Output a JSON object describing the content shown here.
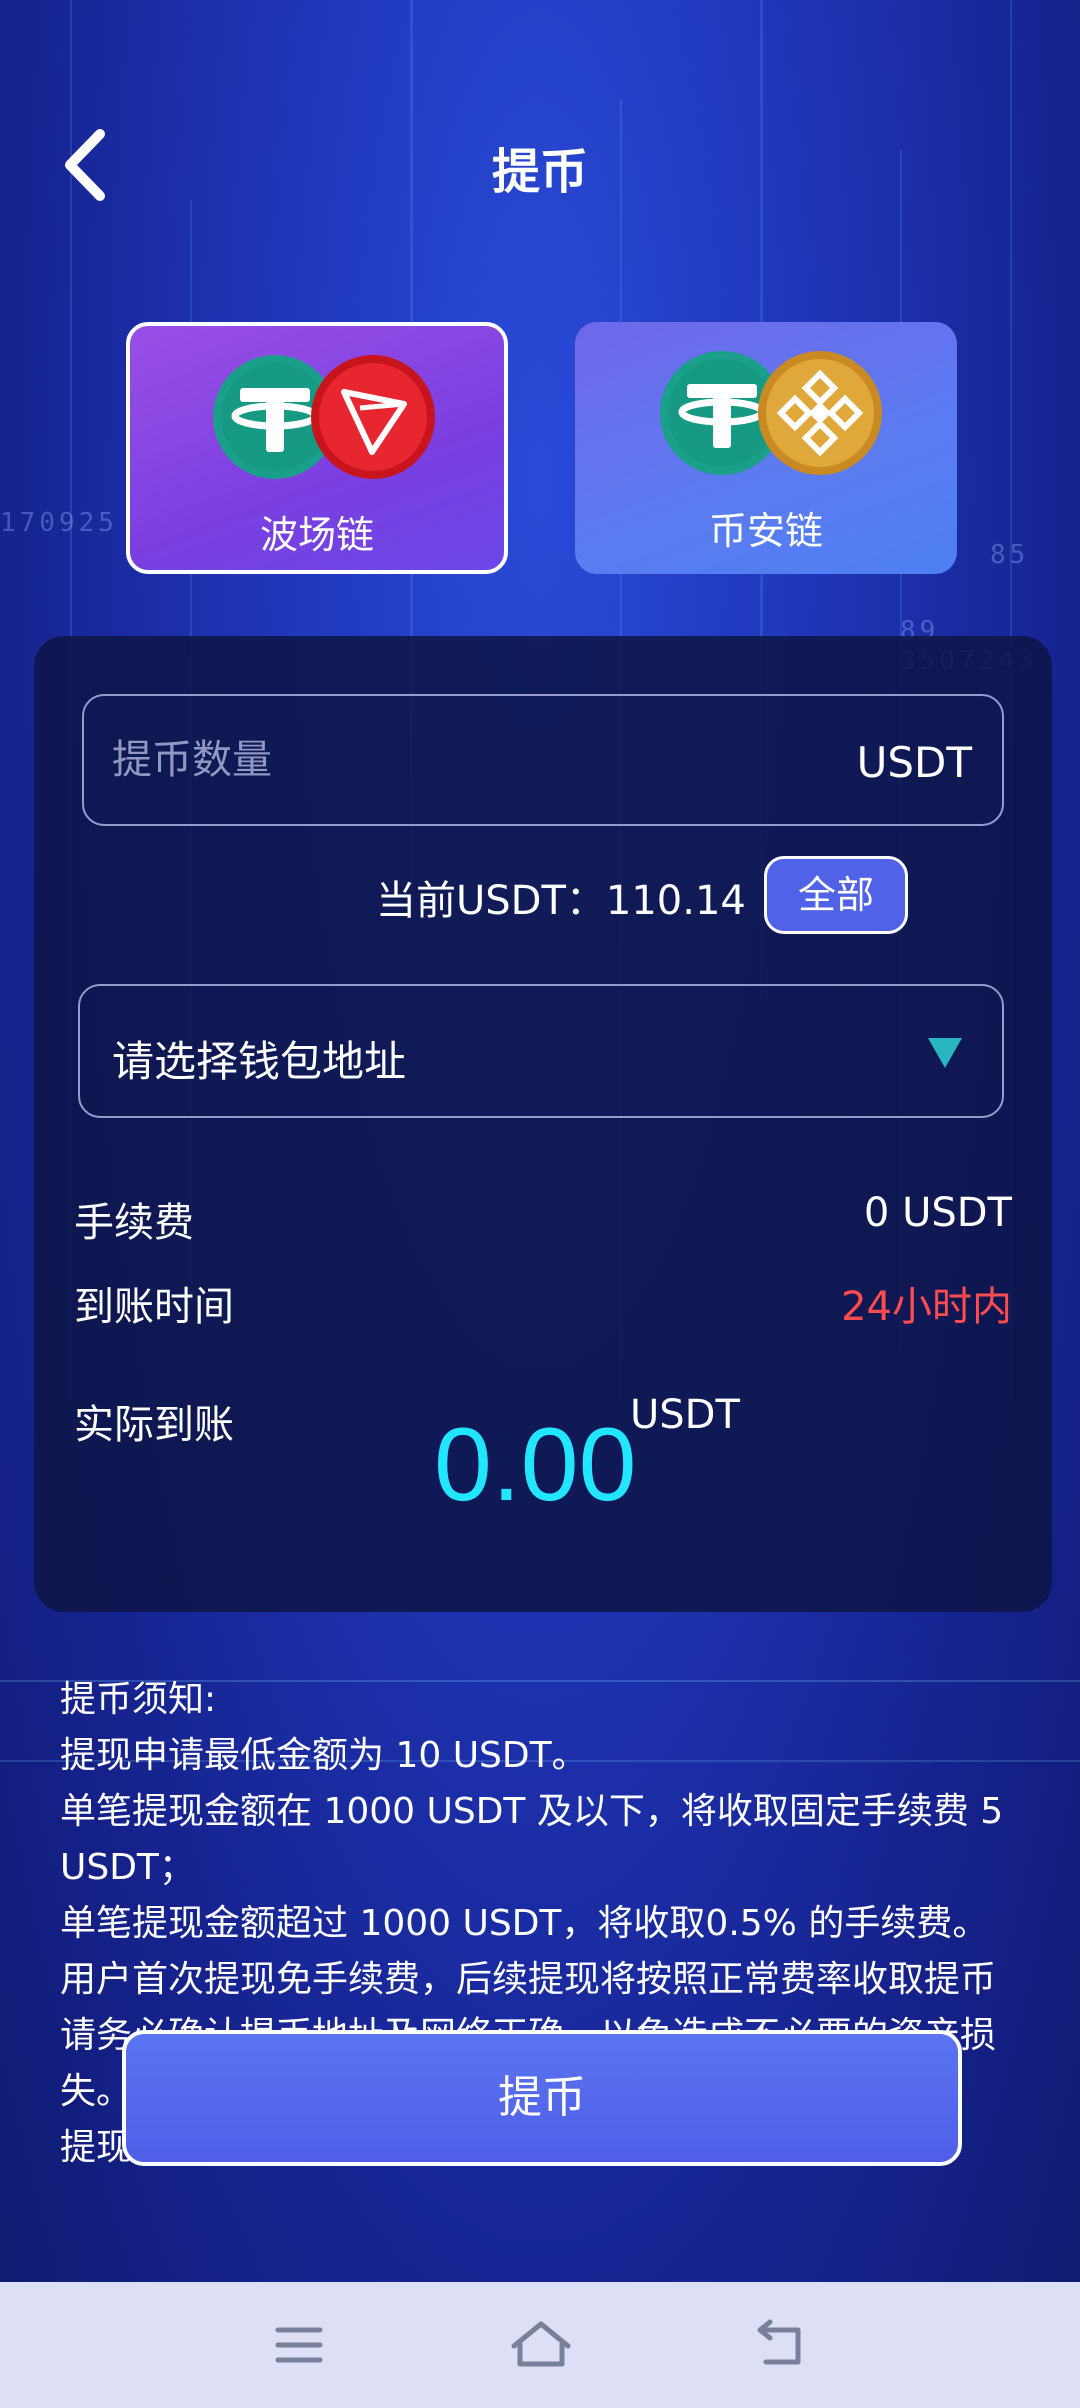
{
  "header": {
    "title": "提币"
  },
  "chains": [
    {
      "label": "波场链",
      "selected": true,
      "icons": [
        "tether-icon",
        "tron-icon"
      ]
    },
    {
      "label": "币安链",
      "selected": false,
      "icons": [
        "tether-icon",
        "bnb-icon"
      ]
    }
  ],
  "colors": {
    "tether": "#1aa08a",
    "tron": "#e8262f",
    "bnb": "#e0a83a",
    "accent_cyan": "#22e6ff",
    "warning_red": "#ff4d4f"
  },
  "amount": {
    "placeholder": "提币数量",
    "unit": "USDT"
  },
  "balance": {
    "text": "当前USDT：110.14",
    "all_label": "全部"
  },
  "wallet": {
    "placeholder": "请选择钱包地址"
  },
  "fee": {
    "label": "手续费",
    "value": "0 USDT"
  },
  "arrival": {
    "label": "到账时间",
    "value": "24小时内"
  },
  "actual": {
    "label": "实际到账",
    "value": "0.00",
    "unit": "USDT"
  },
  "notice": {
    "title": "提币须知:",
    "lines": [
      "提现申请最低金额为 10 USDT。",
      "单笔提现金额在 1000 USDT 及以下，将收取固定手续费 5 USDT；",
      "单笔提现金额超过 1000 USDT，将收取0.5% 的手续费。",
      "用户首次提现免手续费，后续提现将按照正常费率收取提币",
      "请务必确认提币地址及网络正确，以免造成不必要的资产损失。",
      "提现申请提交后，预计资金将在24 小时内到账，具体到"
    ]
  },
  "submit": {
    "label": "提币"
  },
  "navbar": {
    "buttons": [
      "menu-icon",
      "home-icon",
      "back-icon"
    ]
  }
}
